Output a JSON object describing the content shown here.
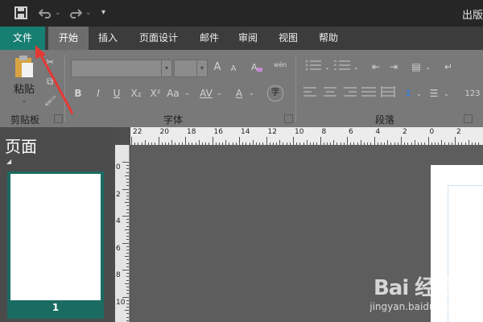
{
  "titlebar": {
    "save_icon": "floppy-save-icon",
    "undo_icon": "undo-icon",
    "redo_icon": "redo-icon",
    "app_title": "出版"
  },
  "tabs": [
    "文件",
    "开始",
    "插入",
    "页面设计",
    "邮件",
    "审阅",
    "视图",
    "帮助"
  ],
  "active_tab": "开始",
  "ribbon": {
    "clipboard": {
      "paste_label": "粘贴",
      "group_label": "剪贴板"
    },
    "font": {
      "group_label": "字体",
      "bold": "B",
      "italic": "I",
      "underline": "U",
      "subscript": "X₂",
      "superscript": "X²",
      "change_case": "Aa",
      "char_spacing": "AV",
      "font_color": "A",
      "grow": "A",
      "shrink": "A",
      "wen_label": "wén",
      "char_label": "字"
    },
    "paragraph": {
      "group_label": "段落",
      "numbering_label": "123"
    }
  },
  "pages_pane": {
    "title": "页面",
    "page_number": "1"
  },
  "hruler_labels": [
    "22",
    "20",
    "18",
    "16",
    "14",
    "12",
    "10",
    "8",
    "6",
    "4",
    "2",
    "0",
    "2"
  ],
  "vruler_labels": [
    "0",
    "2",
    "4",
    "6",
    "8",
    "10"
  ],
  "watermark": {
    "brand": "Bai 经验",
    "url": "jingyan.baidu.com"
  },
  "colors": {
    "file_tab": "#177e72",
    "annotation_arrow": "#e53935"
  }
}
